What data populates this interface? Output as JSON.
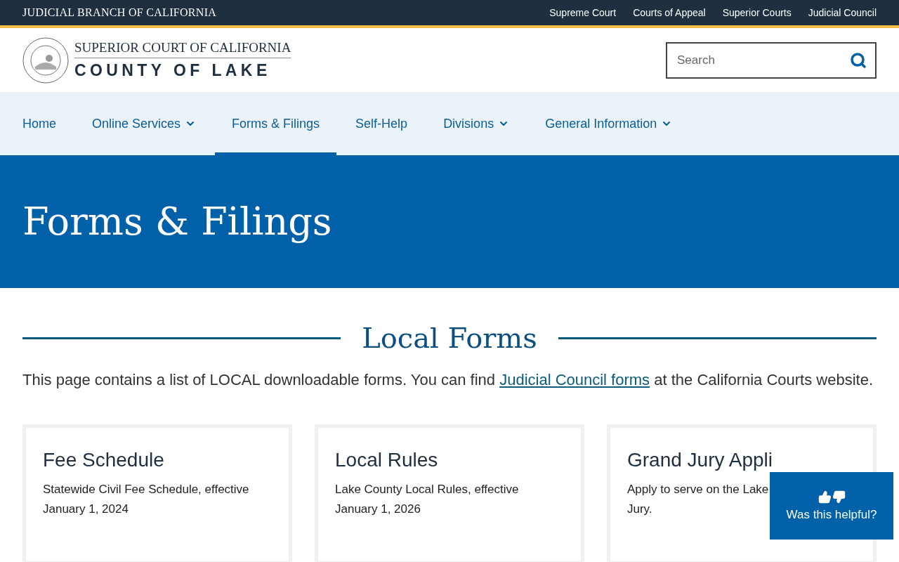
{
  "utility_bar": {
    "title": "JUDICIAL BRANCH OF CALIFORNIA",
    "links": [
      "Supreme Court",
      "Courts of Appeal",
      "Superior Courts",
      "Judicial Council"
    ]
  },
  "header": {
    "logo_line1": "SUPERIOR COURT OF CALIFORNIA",
    "logo_line2": "COUNTY OF LAKE",
    "search": {
      "placeholder": "Search"
    }
  },
  "nav": [
    {
      "label": "Home",
      "has_menu": false,
      "selected": false
    },
    {
      "label": "Online Services",
      "has_menu": true,
      "selected": false
    },
    {
      "label": "Forms & Filings",
      "has_menu": false,
      "selected": true
    },
    {
      "label": "Self-Help",
      "has_menu": false,
      "selected": false
    },
    {
      "label": "Divisions",
      "has_menu": true,
      "selected": false
    },
    {
      "label": "General Information",
      "has_menu": true,
      "selected": false
    }
  ],
  "hero": {
    "title": "Forms & Filings"
  },
  "section": {
    "heading": "Local Forms",
    "intro_before": "This page contains a list of LOCAL downloadable forms. You can find ",
    "intro_link": "Judicial Council forms",
    "intro_after": " at the California Courts website."
  },
  "cards": [
    {
      "title": "Fee Schedule",
      "lines": [
        "Statewide Civil Fee Schedule, effective January 1, 2024"
      ]
    },
    {
      "title": "Local Rules",
      "lines": [
        "Lake County Local Rules, effective January 1, 2026"
      ]
    },
    {
      "title": "Grand Jury Appli",
      "lines": [
        "Apply to serve on the Lake",
        "Jury."
      ]
    }
  ],
  "feedback": {
    "label": "Was this helpful?"
  }
}
